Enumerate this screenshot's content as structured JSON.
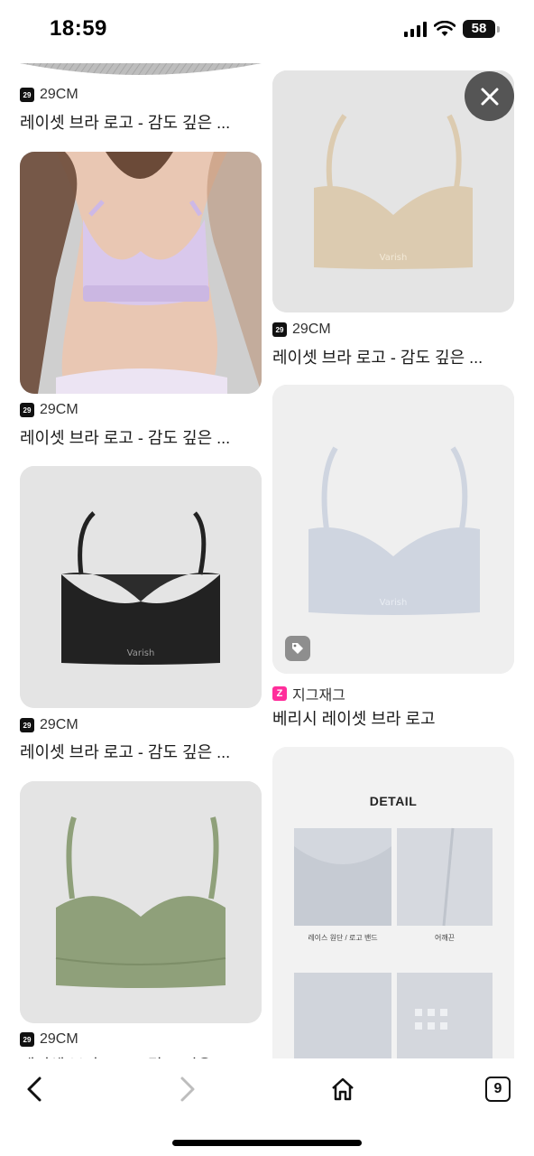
{
  "status_bar": {
    "time": "18:59",
    "battery": "58"
  },
  "left_column": [
    {
      "source": "29CM",
      "badge": "29",
      "title": "레이셋 브라 로고 - 감도 깊은 ...",
      "image": "cropped-gray-fabric"
    },
    {
      "source": "29CM",
      "badge": "29",
      "title": "레이셋 브라 로고 - 감도 깊은 ...",
      "image": "model-lavender-bra"
    },
    {
      "source": "29CM",
      "badge": "29",
      "title": "레이셋 브라 로고 - 감도 깊은 ...",
      "image": "black-bra",
      "logo": "Varish"
    },
    {
      "source": "29CM",
      "badge": "29",
      "title": "레이셋 브라 로고 - 감도 깊은 ...",
      "image": "olive-bra"
    }
  ],
  "right_column": [
    {
      "source": "29CM",
      "badge": "29",
      "title": "레이셋 브라 로고 - 감도 깊은 ...",
      "image": "beige-bra",
      "logo": "Varish"
    },
    {
      "source": "지그재그",
      "badge": "Z",
      "title": "베리시 레이셋 브라 로고",
      "image": "light-blue-bra",
      "logo": "Varish",
      "has_tag_icon": true
    },
    {
      "image": "detail-sheet",
      "heading": "DETAIL",
      "captions": [
        "레이스 원단 / 로고 밴드",
        "어깨끈"
      ]
    }
  ],
  "toolbar": {
    "tab_count": "9"
  },
  "colors": {
    "lavender": "#d9c8ec",
    "black": "#222222",
    "olive": "#8fa07a",
    "beige": "#dccbb0",
    "light_blue": "#cfd5e0",
    "zigzag_pink": "#ff2e9b"
  }
}
